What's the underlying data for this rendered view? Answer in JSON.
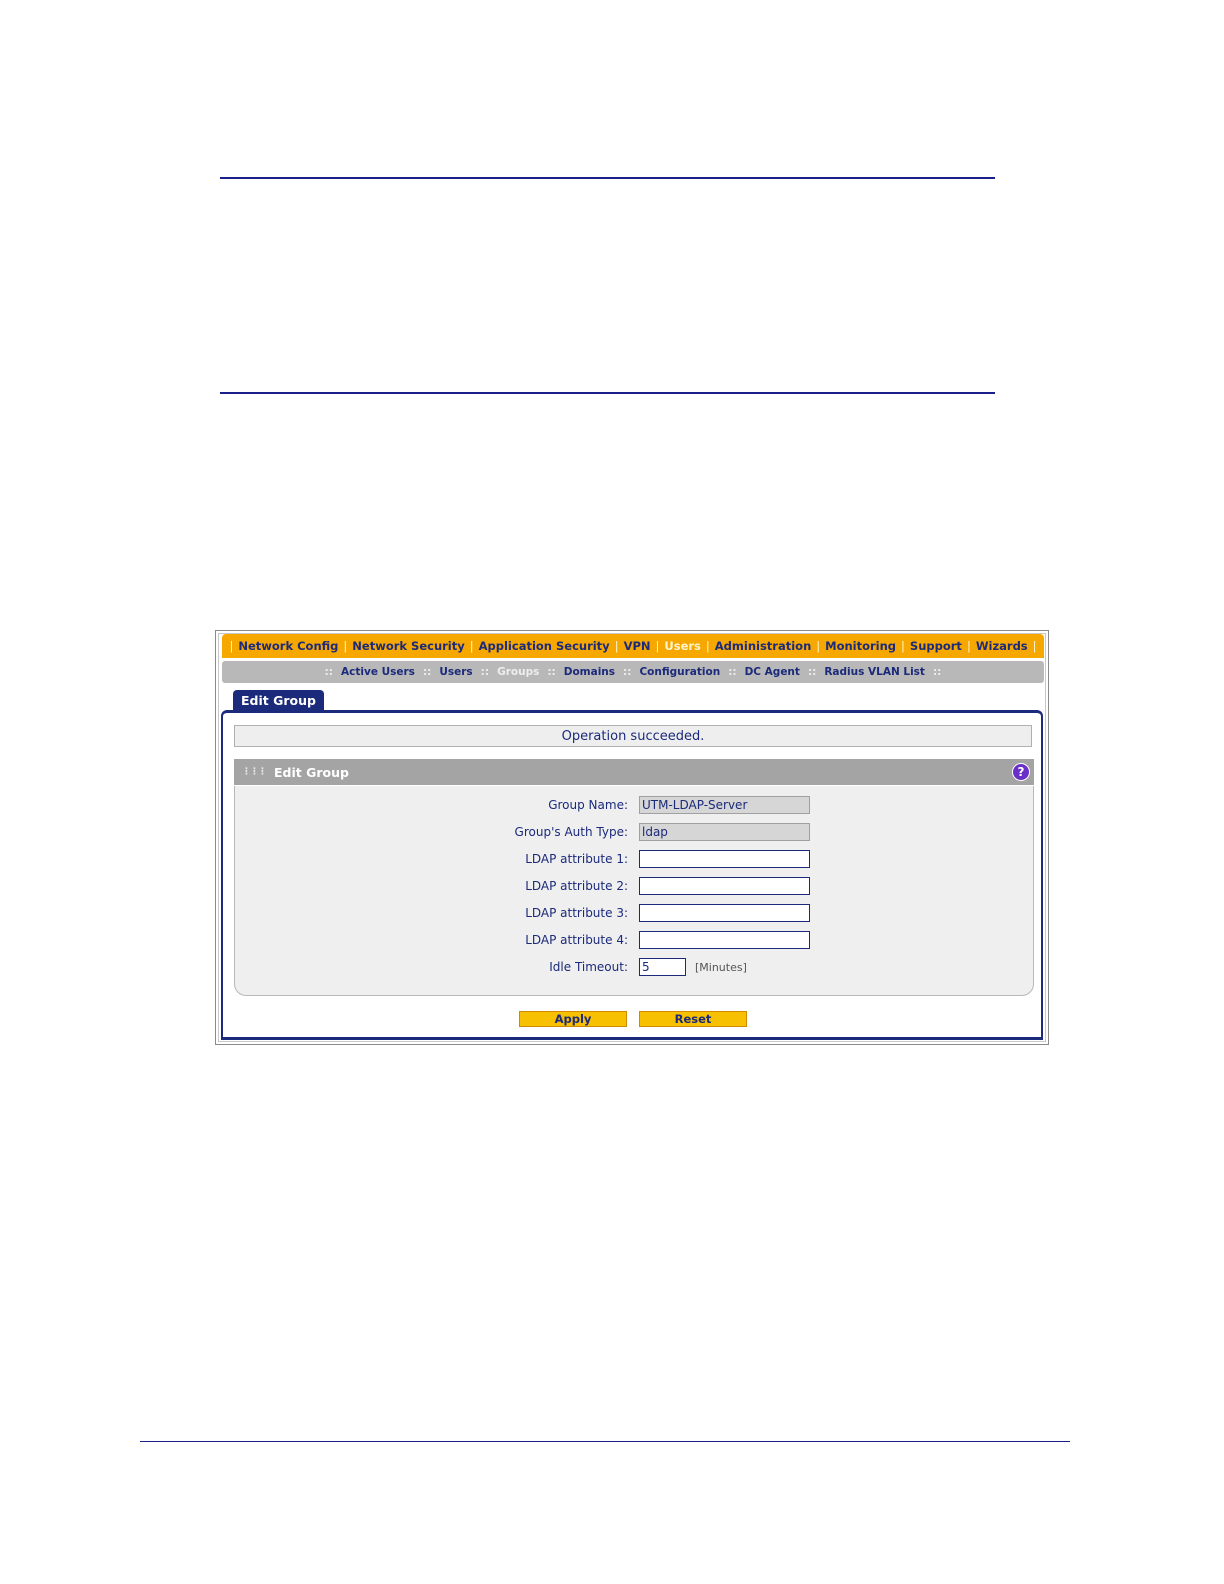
{
  "top_nav": {
    "items": [
      {
        "label": "Network Config",
        "active": false
      },
      {
        "label": "Network Security",
        "active": false
      },
      {
        "label": "Application Security",
        "active": false
      },
      {
        "label": "VPN",
        "active": false
      },
      {
        "label": "Users",
        "active": true
      },
      {
        "label": "Administration",
        "active": false
      },
      {
        "label": "Monitoring",
        "active": false
      },
      {
        "label": "Support",
        "active": false
      },
      {
        "label": "Wizards",
        "active": false
      }
    ],
    "separator": "|"
  },
  "sub_nav": {
    "items": [
      {
        "label": "Active Users",
        "active": false
      },
      {
        "label": "Users",
        "active": false
      },
      {
        "label": "Groups",
        "active": true
      },
      {
        "label": "Domains",
        "active": false
      },
      {
        "label": "Configuration",
        "active": false
      },
      {
        "label": "DC Agent",
        "active": false
      },
      {
        "label": "Radius VLAN List",
        "active": false
      }
    ],
    "separator": "::"
  },
  "tab": {
    "label": "Edit Group"
  },
  "status": {
    "message": "Operation succeeded."
  },
  "section": {
    "title": "Edit Group",
    "help_icon": "question-icon",
    "help_glyph": "?"
  },
  "form": {
    "group_name": {
      "label": "Group Name:",
      "value": "UTM-LDAP-Server"
    },
    "auth_type": {
      "label": "Group's Auth Type:",
      "value": "ldap"
    },
    "ldap_attr_1": {
      "label": "LDAP attribute 1:",
      "value": ""
    },
    "ldap_attr_2": {
      "label": "LDAP attribute 2:",
      "value": ""
    },
    "ldap_attr_3": {
      "label": "LDAP attribute 3:",
      "value": ""
    },
    "ldap_attr_4": {
      "label": "LDAP attribute 4:",
      "value": ""
    },
    "idle_timeout": {
      "label": "Idle Timeout:",
      "value": "5",
      "unit": "[Minutes]"
    }
  },
  "buttons": {
    "apply": "Apply",
    "reset": "Reset"
  },
  "colors": {
    "nav_orange": "#f7a800",
    "navy": "#1b2a7a",
    "button_yellow": "#f7c000"
  }
}
